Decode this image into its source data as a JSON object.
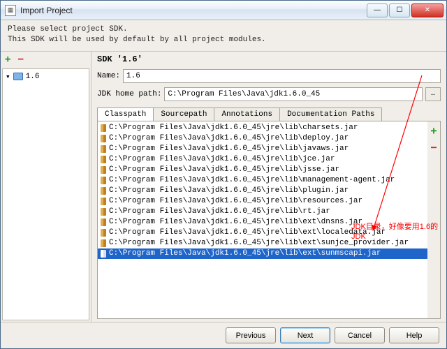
{
  "titlebar": {
    "title": "Import Project"
  },
  "instructions": {
    "line1": "Please select project SDK.",
    "line2": "This SDK will be used by default by all project modules."
  },
  "sidebar": {
    "items": [
      {
        "label": "1.6"
      }
    ]
  },
  "sdk": {
    "heading": "SDK '1.6'",
    "name_label": "Name:",
    "name_value": "1.6",
    "home_label": "JDK home path:",
    "home_value": "C:\\Program Files\\Java\\jdk1.6.0_45"
  },
  "tabs": [
    {
      "label": "Classpath"
    },
    {
      "label": "Sourcepath"
    },
    {
      "label": "Annotations"
    },
    {
      "label": "Documentation Paths"
    }
  ],
  "classpath": [
    "C:\\Program Files\\Java\\jdk1.6.0_45\\jre\\lib\\charsets.jar",
    "C:\\Program Files\\Java\\jdk1.6.0_45\\jre\\lib\\deploy.jar",
    "C:\\Program Files\\Java\\jdk1.6.0_45\\jre\\lib\\javaws.jar",
    "C:\\Program Files\\Java\\jdk1.6.0_45\\jre\\lib\\jce.jar",
    "C:\\Program Files\\Java\\jdk1.6.0_45\\jre\\lib\\jsse.jar",
    "C:\\Program Files\\Java\\jdk1.6.0_45\\jre\\lib\\management-agent.jar",
    "C:\\Program Files\\Java\\jdk1.6.0_45\\jre\\lib\\plugin.jar",
    "C:\\Program Files\\Java\\jdk1.6.0_45\\jre\\lib\\resources.jar",
    "C:\\Program Files\\Java\\jdk1.6.0_45\\jre\\lib\\rt.jar",
    "C:\\Program Files\\Java\\jdk1.6.0_45\\jre\\lib\\ext\\dnsns.jar",
    "C:\\Program Files\\Java\\jdk1.6.0_45\\jre\\lib\\ext\\localedata.jar",
    "C:\\Program Files\\Java\\jdk1.6.0_45\\jre\\lib\\ext\\sunjce_provider.jar",
    "C:\\Program Files\\Java\\jdk1.6.0_45\\jre\\lib\\ext\\sunmscapi.jar"
  ],
  "selected_index": 12,
  "footer": {
    "previous": "Previous",
    "next": "Next",
    "cancel": "Cancel",
    "help": "Help"
  },
  "annotation": "JDK目录，好像要用1.6的JDK"
}
